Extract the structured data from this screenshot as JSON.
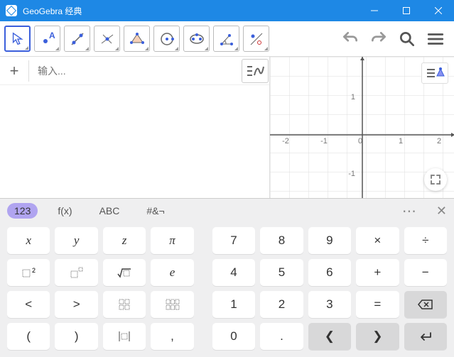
{
  "app": {
    "title": "GeoGebra 经典"
  },
  "input": {
    "placeholder": "输入..."
  },
  "graph": {
    "x_ticks": [
      -2,
      -1,
      0,
      1,
      2
    ],
    "y_ticks": [
      -1,
      1
    ]
  },
  "kb": {
    "tabs": {
      "num": "123",
      "fx": "f(x)",
      "abc": "ABC",
      "sym": "#&¬"
    },
    "x": "x",
    "y": "y",
    "z": "z",
    "pi": "π",
    "sq": "⸬²",
    "pow": "⸬ ͐",
    "sqrt": "√▫",
    "e": "e",
    "lt": "<",
    "gt": ">",
    "mat1": "⁞⁞",
    "mat2": "⁞⁞⁞",
    "lp": "(",
    "rp": ")",
    "mat3": "|⁞⁞|",
    "comma": ",",
    "k7": "7",
    "k8": "8",
    "k9": "9",
    "mul": "×",
    "div": "÷",
    "k4": "4",
    "k5": "5",
    "k6": "6",
    "plus": "+",
    "minus": "−",
    "k1": "1",
    "k2": "2",
    "k3": "3",
    "eq": "=",
    "bsp": "⌫",
    "k0": "0",
    "dot": ".",
    "left": "❮",
    "right": "❯",
    "enter": "↩"
  },
  "more": "⋯"
}
